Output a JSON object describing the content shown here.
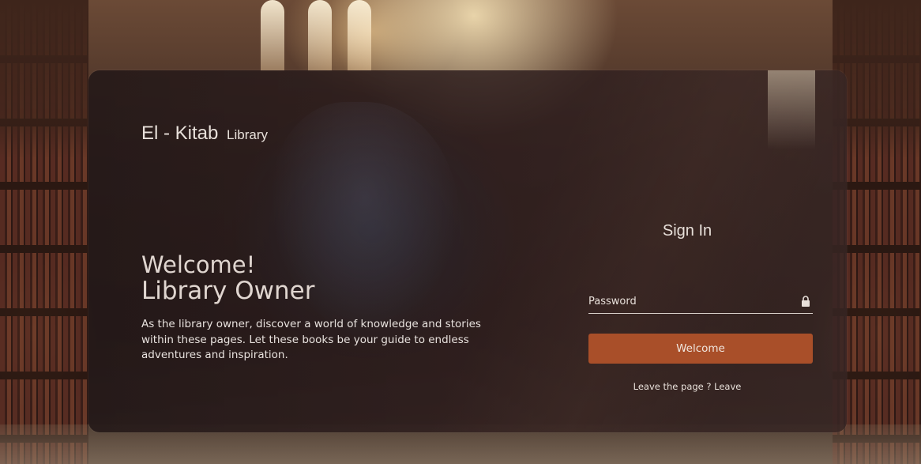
{
  "brand": {
    "name": "El - Kitab",
    "subtitle": "Library"
  },
  "hero": {
    "greeting": "Welcome!",
    "role": "Library Owner",
    "description": "As the library owner, discover a world of knowledge and stories within these pages. Let these books be your guide to endless adventures and inspiration."
  },
  "signin": {
    "title": "Sign In",
    "password_placeholder": "Password",
    "password_icon": "lock-icon",
    "submit_label": "Welcome",
    "leave_prompt": "Leave the page ?",
    "leave_link": "Leave"
  },
  "colors": {
    "accent": "#a94f29",
    "text": "#e8e0da"
  }
}
